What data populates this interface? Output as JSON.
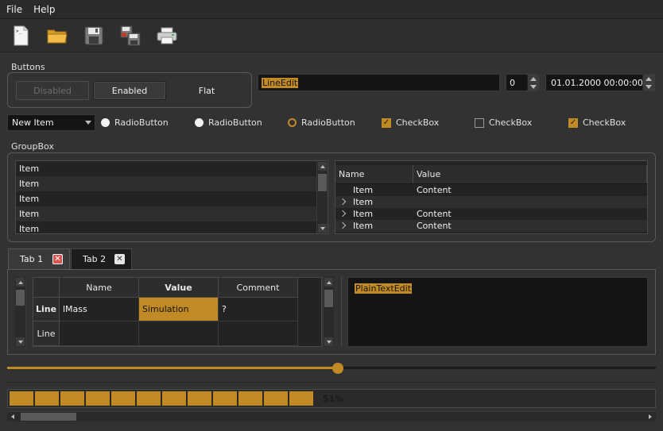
{
  "menu": {
    "items": [
      "File",
      "Help"
    ]
  },
  "toolbar": {
    "icons": [
      "new-document-icon",
      "open-folder-icon",
      "save-icon",
      "save-all-icon",
      "print-icon"
    ]
  },
  "buttons_group": {
    "title": "Buttons",
    "disabled_label": "Disabled",
    "enabled_label": "Enabled",
    "flat_label": "Flat"
  },
  "line_edit": {
    "value": "LineEdit"
  },
  "spinbox": {
    "value": "0"
  },
  "datetime": {
    "value": "01.01.2000  00:00:00"
  },
  "combo": {
    "value": "New Item"
  },
  "radios": [
    {
      "label": "RadioButton",
      "state": "off"
    },
    {
      "label": "RadioButton",
      "state": "off"
    },
    {
      "label": "RadioButton",
      "state": "hover"
    }
  ],
  "checkboxes": [
    {
      "label": "CheckBox",
      "checked": true
    },
    {
      "label": "CheckBox",
      "checked": false
    },
    {
      "label": "CheckBox",
      "checked": true
    }
  ],
  "group_box": {
    "title": "GroupBox",
    "list_items": [
      "Item",
      "Item",
      "Item",
      "Item",
      "Item"
    ],
    "tree": {
      "headers": [
        "Name",
        "Value"
      ],
      "rows": [
        {
          "name": "Item",
          "value": "Content",
          "expandable": false
        },
        {
          "name": "Item",
          "value": "",
          "expandable": true
        },
        {
          "name": "Item",
          "value": "Content",
          "expandable": true
        },
        {
          "name": "Item",
          "value": "Content",
          "expandable": true
        }
      ]
    }
  },
  "tabs": [
    {
      "label": "Tab 1",
      "active": true
    },
    {
      "label": "Tab 2",
      "active": false
    }
  ],
  "table": {
    "headers": [
      "Name",
      "Value",
      "Comment"
    ],
    "rows": [
      {
        "header": "Line",
        "cells": [
          "lMass",
          "Simulation",
          "?"
        ]
      },
      {
        "header": "Line",
        "cells": [
          "",
          "",
          ""
        ]
      }
    ]
  },
  "plain_text_edit": {
    "value": "PlainTextEdit"
  },
  "slider": {
    "value_fraction": 0.51
  },
  "progress": {
    "value_percent": 51,
    "text": "51%"
  },
  "colors": {
    "accent": "#c28a24",
    "background": "#323232",
    "field": "#141414"
  }
}
